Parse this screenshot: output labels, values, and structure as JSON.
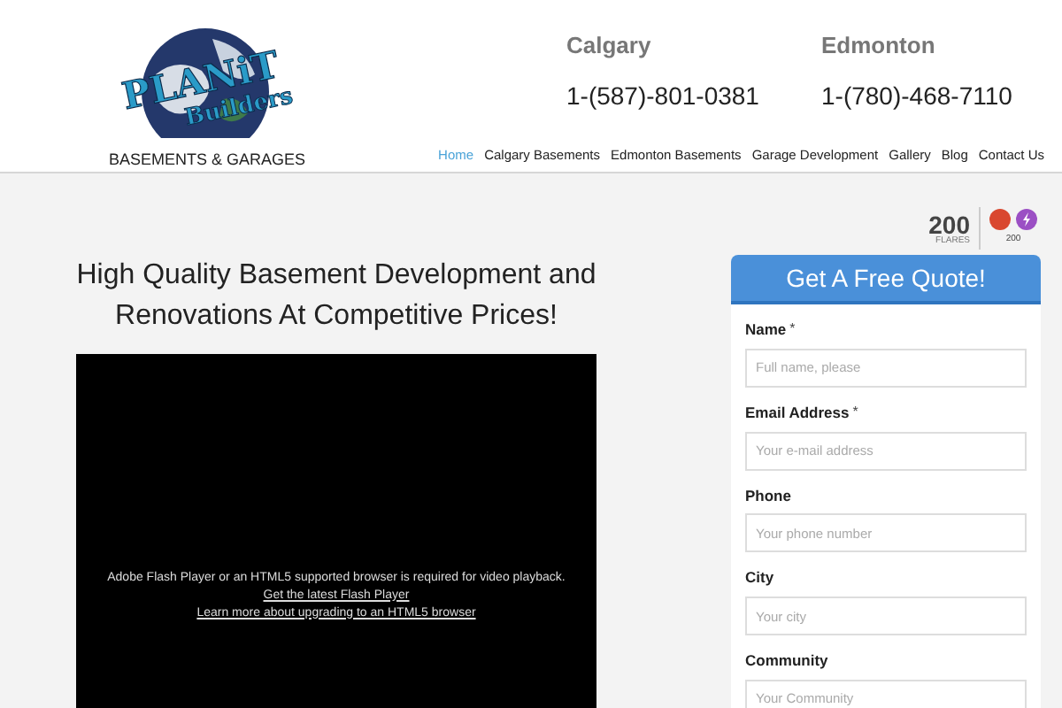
{
  "logo": {
    "name_line1": "PLANiT",
    "name_line2": "Builders",
    "tagline": "BASEMENTS & GARAGES"
  },
  "locations": [
    {
      "city": "Calgary",
      "phone": "1-(587)-801-0381"
    },
    {
      "city": "Edmonton",
      "phone": "1-(780)-468-7110"
    }
  ],
  "nav": [
    {
      "label": "Home",
      "selected": true
    },
    {
      "label": "Calgary Basements",
      "selected": false
    },
    {
      "label": "Edmonton Basements",
      "selected": false
    },
    {
      "label": "Garage Development",
      "selected": false
    },
    {
      "label": "Gallery",
      "selected": false
    },
    {
      "label": "Blog",
      "selected": false
    },
    {
      "label": "Contact Us",
      "selected": false
    }
  ],
  "headline": "High Quality Basement Development and Renovations At Competitive Prices!",
  "video": {
    "message": "Adobe Flash Player or an HTML5 supported browser is required for video playback.",
    "links": [
      "Get the latest Flash Player",
      "Learn more about upgrading to an HTML5 browser"
    ]
  },
  "flares": {
    "count": "200",
    "label": "FLARES",
    "share_count": "200"
  },
  "quote_form": {
    "title": "Get A Free Quote!",
    "fields": [
      {
        "label": "Name",
        "required_mark": "*",
        "placeholder": "Full name, please"
      },
      {
        "label": "Email Address",
        "required_mark": "*",
        "placeholder": "Your e-mail address"
      },
      {
        "label": "Phone",
        "placeholder": "Your phone number"
      },
      {
        "label": "City",
        "placeholder": "Your city"
      },
      {
        "label": "Community",
        "placeholder": "Your Community"
      }
    ]
  }
}
